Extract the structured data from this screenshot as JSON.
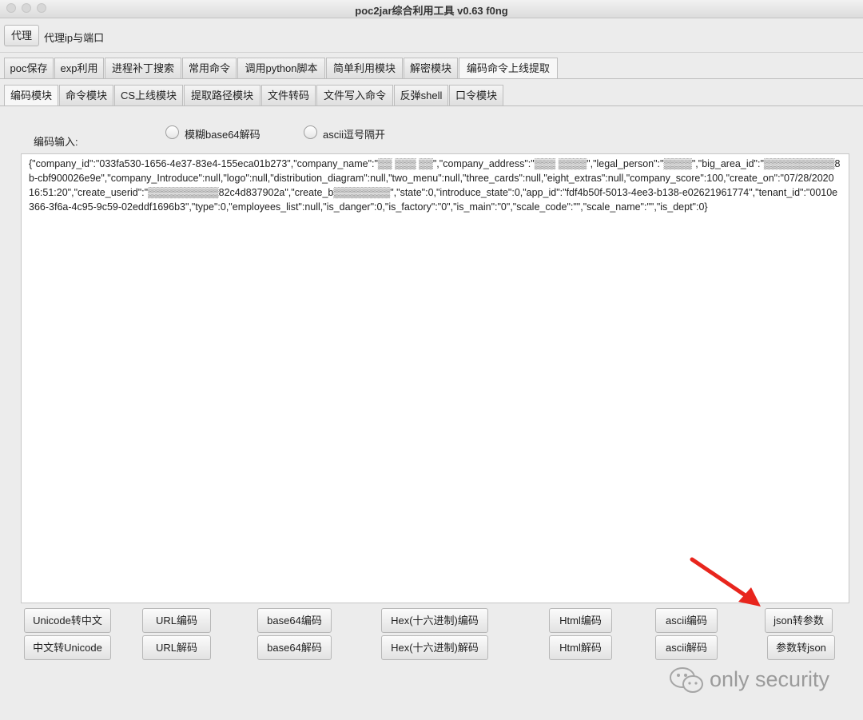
{
  "window": {
    "title": "poc2jar综合利用工具 v0.63  f0ng"
  },
  "proxy": {
    "button": "代理",
    "label": "代理ip与端口"
  },
  "main_tabs": [
    {
      "label": "poc保存"
    },
    {
      "label": "exp利用"
    },
    {
      "label": "进程补丁搜索"
    },
    {
      "label": "常用命令"
    },
    {
      "label": "调用python脚本"
    },
    {
      "label": "简单利用模块"
    },
    {
      "label": "解密模块"
    },
    {
      "label": "编码命令上线提取",
      "active": true
    }
  ],
  "sub_tabs": [
    {
      "label": "编码模块",
      "active": true
    },
    {
      "label": "命令模块"
    },
    {
      "label": "CS上线模块"
    },
    {
      "label": "提取路径模块"
    },
    {
      "label": "文件转码"
    },
    {
      "label": "文件写入命令"
    },
    {
      "label": "反弹shell"
    },
    {
      "label": "口令模块"
    }
  ],
  "encode": {
    "input_label": "编码输入:",
    "radio_base64": "模糊base64解码",
    "radio_ascii": "ascii逗号隔开",
    "text": "{\"company_id\":\"033fa530-1656-4e37-83e4-155eca01b273\",\"company_name\":\"▒▒ ▒▒▒ ▒▒\",\"company_address\":\"▒▒▒ ▒▒▒▒\",\"legal_person\":\"▒▒▒▒\",\"big_area_id\":\"▒▒▒▒▒▒▒▒▒▒8b-cbf900026e9e\",\"company_Introduce\":null,\"logo\":null,\"distribution_diagram\":null,\"two_menu\":null,\"three_cards\":null,\"eight_extras\":null,\"company_score\":100,\"create_on\":\"07/28/2020 16:51:20\",\"create_userid\":\"▒▒▒▒▒▒▒▒▒▒82c4d837902a\",\"create_b▒▒▒▒▒▒▒▒\",\"state\":0,\"introduce_state\":0,\"app_id\":\"fdf4b50f-5013-4ee3-b138-e02621961774\",\"tenant_id\":\"0010e366-3f6a-4c95-9c59-02eddf1696b3\",\"type\":0,\"employees_list\":null,\"is_danger\":0,\"is_factory\":\"0\",\"is_main\":\"0\",\"scale_code\":\"\",\"scale_name\":\"\",\"is_dept\":0}"
  },
  "buttons": {
    "unicode_to_cn": "Unicode转中文",
    "cn_to_unicode": "中文转Unicode",
    "url_encode": "URL编码",
    "url_decode": "URL解码",
    "base64_encode": "base64编码",
    "base64_decode": "base64解码",
    "hex_encode": "Hex(十六进制)编码",
    "hex_decode": "Hex(十六进制)解码",
    "html_encode": "Html编码",
    "html_decode": "Html解码",
    "ascii_encode": "ascii编码",
    "ascii_decode": "ascii解码",
    "json_to_param": "json转参数",
    "param_to_json": "参数转json"
  },
  "watermark": {
    "text": "only security",
    "icon": "wechat-icon"
  },
  "annotation": {
    "icon": "arrow-icon",
    "color": "#e8251d"
  }
}
